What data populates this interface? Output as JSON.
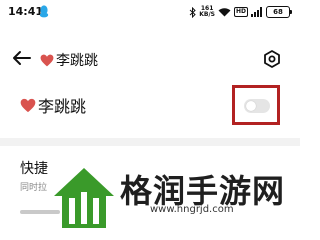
{
  "status_bar": {
    "time": "14:41",
    "net_speed_value": "161",
    "net_speed_unit": "KB/S",
    "hd_label": "HD",
    "battery_level": "68",
    "icons": [
      "qq-icon",
      "bluetooth-icon",
      "wifi-icon",
      "signal-icon",
      "battery-icon"
    ]
  },
  "header": {
    "title": "李跳跳",
    "title_icon": "heart-icon",
    "back_icon": "arrow-left-icon",
    "settings_icon": "gear-icon"
  },
  "contact_row": {
    "name": "李跳跳",
    "name_icon": "heart-icon",
    "toggle_on": false
  },
  "section": {
    "title": "快捷",
    "subtitle": "同时拉"
  },
  "watermark": {
    "name": "格润手游网",
    "url": "www.hngrjd.com"
  },
  "colors": {
    "heart": "#d9534f",
    "highlight_border": "#b22222",
    "qq_blue": "#2aa7e8",
    "watermark_green": "#3a9a2a"
  }
}
